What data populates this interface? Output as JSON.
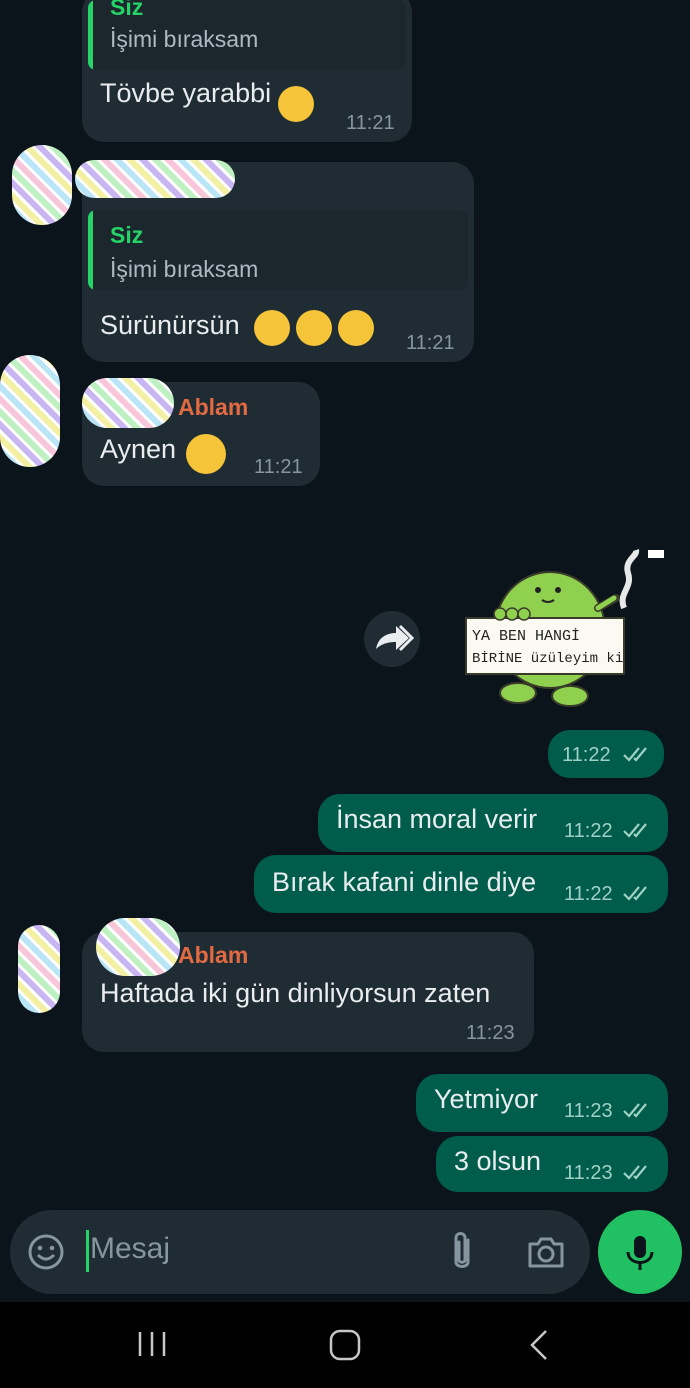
{
  "messages": [
    {
      "id": "m1",
      "dir": "in",
      "quote_name": "Siz",
      "quote_text": "İşimi bıraksam",
      "text": "Tövbe yarabbi",
      "time": "11:21"
    },
    {
      "id": "m2",
      "dir": "in",
      "quote_name": "Siz",
      "quote_text": "İşimi bıraksam",
      "text": "Sürünürsün",
      "time": "11:21"
    },
    {
      "id": "m3",
      "dir": "in",
      "sender": "Ablam",
      "text": "Aynen",
      "time": "11:21"
    },
    {
      "id": "m4",
      "dir": "out",
      "type": "sticker",
      "sticker_text_line1": "YA BEN HANGİ",
      "sticker_text_line2": "BİRİNE üzüleyim ki",
      "time": "11:22",
      "status": "read"
    },
    {
      "id": "m5",
      "dir": "out",
      "text": "İnsan moral verir",
      "time": "11:22",
      "status": "read"
    },
    {
      "id": "m6",
      "dir": "out",
      "text": "Bırak kafani dinle diye",
      "time": "11:22",
      "status": "read"
    },
    {
      "id": "m7",
      "dir": "in",
      "sender": "Ablam",
      "text": "Haftada iki gün dinliyorsun zaten",
      "time": "11:23"
    },
    {
      "id": "m8",
      "dir": "out",
      "text": "Yetmiyor",
      "time": "11:23",
      "status": "read"
    },
    {
      "id": "m9",
      "dir": "out",
      "text": "3 olsun",
      "time": "11:23",
      "status": "read"
    }
  ],
  "composer": {
    "placeholder": "Mesaj"
  },
  "icons": {
    "emoji": "emoji-icon",
    "attach": "paperclip-icon",
    "camera": "camera-icon",
    "mic": "microphone-icon",
    "forward": "forward-icon"
  },
  "colors": {
    "background": "#0b141a",
    "incoming": "#202c33",
    "outgoing": "#005c4b",
    "accent": "#25d366",
    "sender": "#e26a42"
  }
}
